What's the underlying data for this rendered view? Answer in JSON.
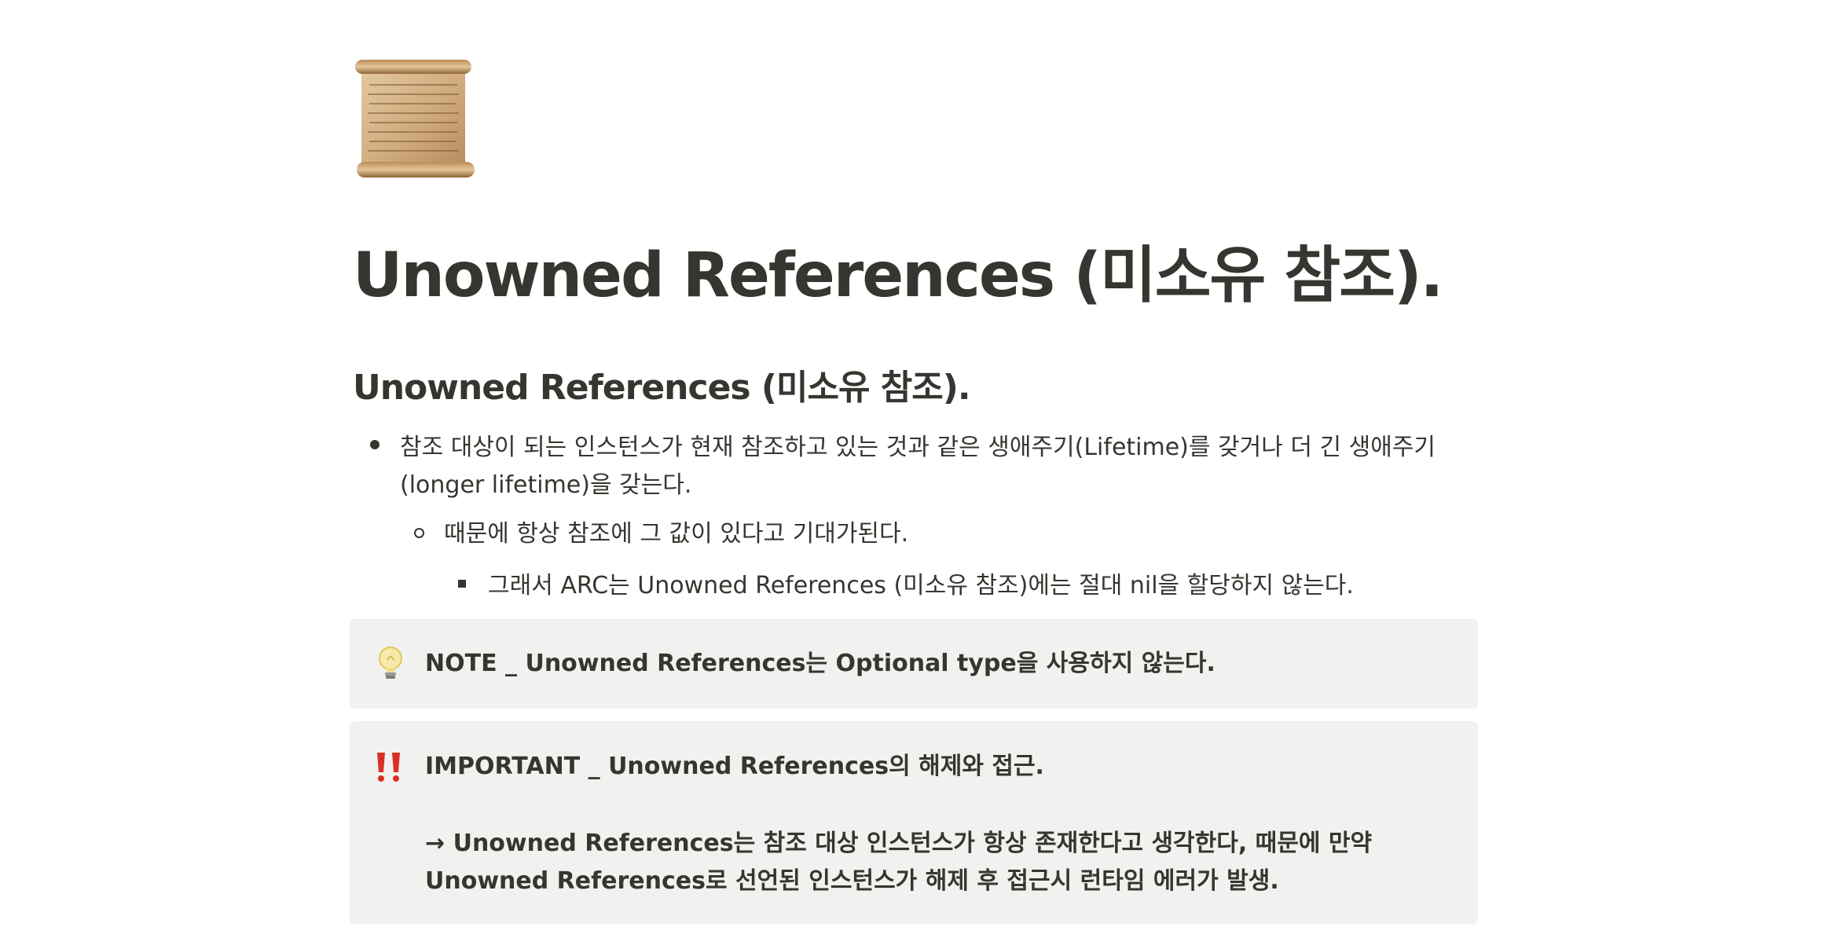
{
  "page": {
    "icon": "scroll-icon",
    "title": "Unowned References (미소유 참조)."
  },
  "section": {
    "heading": "Unowned References (미소유 참조).",
    "bullets": [
      {
        "level": 1,
        "text": "참조 대상이 되는 인스턴스가 현재 참조하고 있는 것과 같은 생애주기(Lifetime)를 갖거나 더 긴 생애주기(longer lifetime)을 갖는다."
      },
      {
        "level": 2,
        "text": "때문에 항상 참조에 그 값이 있다고 기대가된다."
      },
      {
        "level": 3,
        "text": "그래서 ARC는 Unowned References (미소유 참조)에는 절대 nil을 할당하지 않는다."
      }
    ]
  },
  "callouts": [
    {
      "icon": "light-bulb-icon",
      "lines": [
        "NOTE _ Unowned References는 Optional type을 사용하지 않는다."
      ]
    },
    {
      "icon": "double-exclamation-icon",
      "lines": [
        "IMPORTANT _ Unowned References의 해제와 접근.",
        "",
        "→ Unowned References는 참조 대상 인스턴스가 항상 존재한다고 생각한다, 때문에 만약",
        "Unowned References로 선언된 인스턴스가 해제 후 접근시 런타임 에러가 발생."
      ]
    }
  ],
  "colors": {
    "text": "#37352f",
    "callout_bg": "#f1f1ef",
    "exclamation": "#d93025",
    "scroll": "#c9a578"
  }
}
